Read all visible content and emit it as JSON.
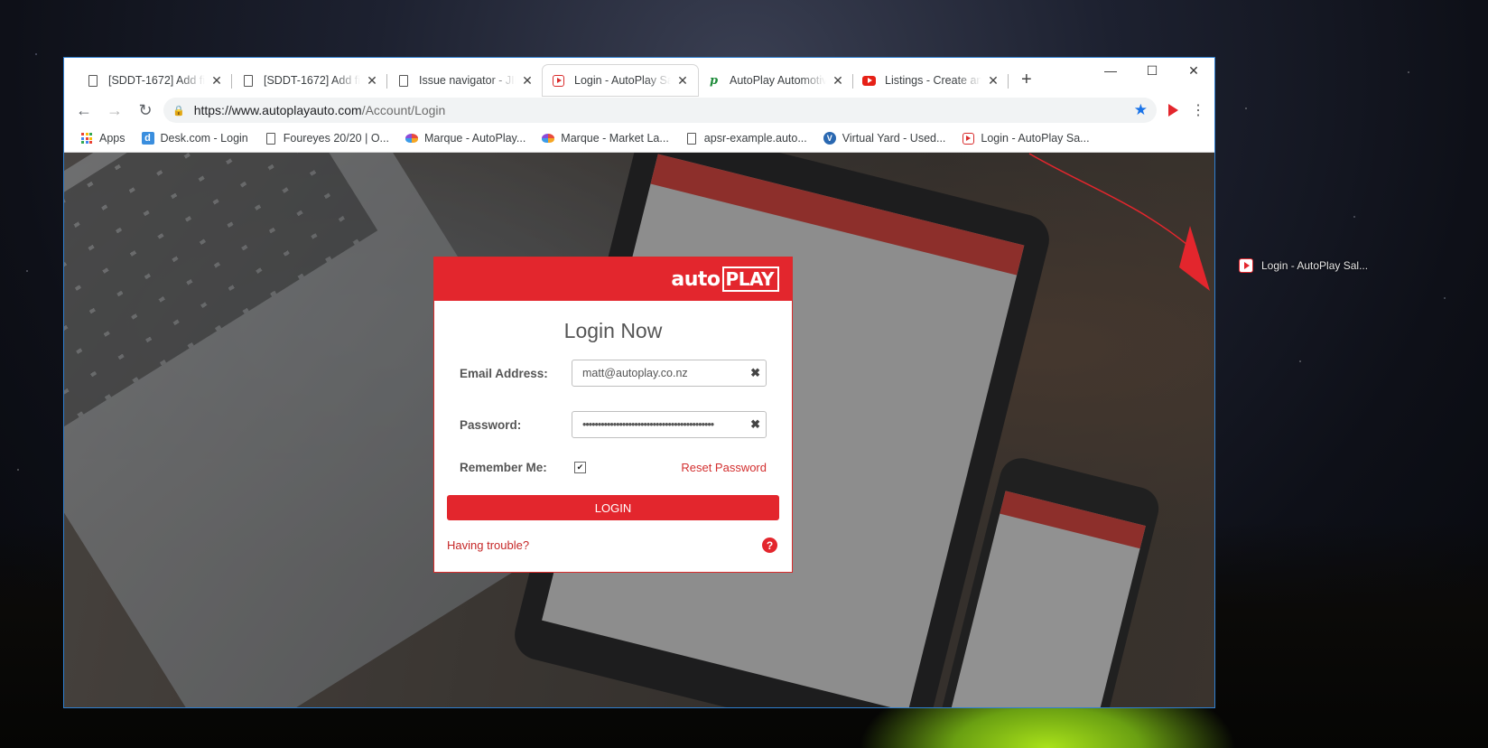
{
  "browser": {
    "tabs": [
      {
        "title": "[SDDT-1672] Add fie",
        "icon": "document-icon"
      },
      {
        "title": "[SDDT-1672] Add fie",
        "icon": "document-icon"
      },
      {
        "title": "Issue navigator - JIR",
        "icon": "document-icon"
      },
      {
        "title": "Login - AutoPlay Sal",
        "icon": "autoplay-icon",
        "active": true
      },
      {
        "title": "AutoPlay Automotiv",
        "icon": "green-p-icon"
      },
      {
        "title": "Listings - Create and",
        "icon": "youtube-icon"
      }
    ],
    "new_tab": "+",
    "window_controls": {
      "minimize": "—",
      "maximize": "☐",
      "close": "✕"
    },
    "url_host": "https://www.autoplayauto.com",
    "url_path": "/Account/Login",
    "bookmarks": [
      {
        "label": "Apps",
        "icon": "apps-grid-icon"
      },
      {
        "label": "Desk.com - Login",
        "icon": "desk-icon"
      },
      {
        "label": "Foureyes 20/20 | O...",
        "icon": "document-icon"
      },
      {
        "label": "Marque - AutoPlay...",
        "icon": "marque-icon"
      },
      {
        "label": "Marque - Market La...",
        "icon": "marque-icon"
      },
      {
        "label": "apsr-example.auto...",
        "icon": "document-icon"
      },
      {
        "label": "Virtual Yard - Used...",
        "icon": "virtual-yard-icon"
      },
      {
        "label": "Login - AutoPlay Sa...",
        "icon": "autoplay-icon"
      }
    ]
  },
  "login": {
    "logo_auto": "auto",
    "logo_play": "PLAY",
    "title": "Login Now",
    "email_label": "Email Address:",
    "email_value": "matt@autoplay.co.nz",
    "password_label": "Password:",
    "password_value": "•••••••••••••••••••••••••••••••••••••••••••",
    "remember_label": "Remember Me:",
    "remember_checked": "✔",
    "reset_link": "Reset Password",
    "login_button": "LOGIN",
    "trouble_link": "Having trouble?",
    "help_icon": "?"
  },
  "desktop": {
    "drag_ghost_label": "Login - AutoPlay Sal..."
  },
  "colors": {
    "brand_red": "#e3262d",
    "link_red": "#d32f2f",
    "star_blue": "#1a73e8"
  }
}
